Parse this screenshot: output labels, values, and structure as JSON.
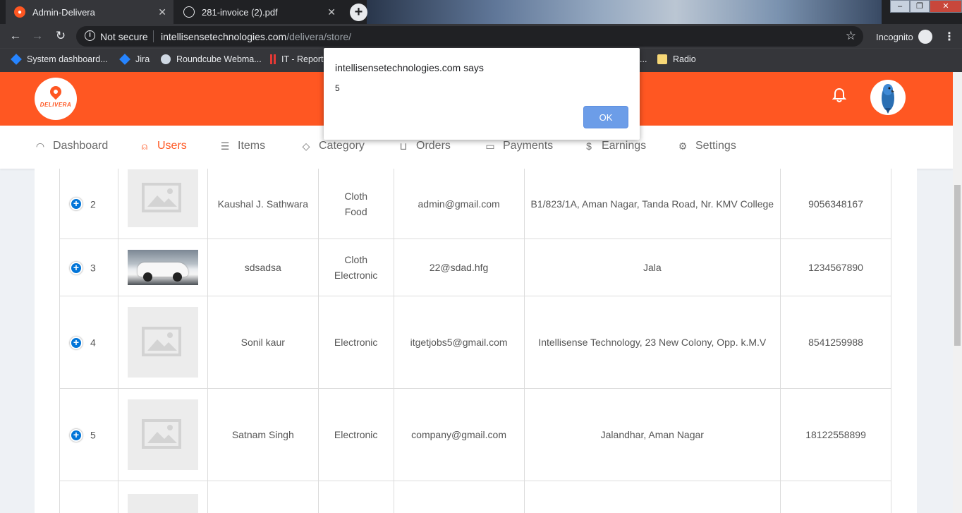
{
  "browser": {
    "tabs": [
      {
        "title": "Admin-Delivera",
        "active": true
      },
      {
        "title": "281-invoice (2).pdf",
        "active": false
      }
    ],
    "new_tab": "+",
    "close_glyph": "✕",
    "security_label": "Not secure",
    "url_host": "intellisensetechnologies.com",
    "url_path": "/delivera/store/",
    "incognito_label": "Incognito",
    "bookmarks": [
      {
        "label": "System dashboard...",
        "icon": "jira-diamond-icon"
      },
      {
        "label": "Jira",
        "icon": "jira-diamond-icon"
      },
      {
        "label": "Roundcube Webma...",
        "icon": "roundcube-icon"
      },
      {
        "label": "IT - Report",
        "icon": "report-icon"
      },
      {
        "label": "...",
        "icon": "none"
      },
      {
        "label": "Radio",
        "icon": "folder-icon"
      }
    ]
  },
  "app": {
    "brand": "DELIVERA",
    "accent_color": "#ff5722",
    "menu": [
      {
        "label": "Dashboard",
        "icon": "speedometer-icon",
        "active": false
      },
      {
        "label": "Users",
        "icon": "user-icon",
        "active": true
      },
      {
        "label": "Items",
        "icon": "list-icon",
        "active": false
      },
      {
        "label": "Category",
        "icon": "tag-icon",
        "active": false
      },
      {
        "label": "Orders",
        "icon": "cart-icon",
        "active": false
      },
      {
        "label": "Payments",
        "icon": "wallet-icon",
        "active": false
      },
      {
        "label": "Earnings",
        "icon": "dollar-icon",
        "active": false
      },
      {
        "label": "Settings",
        "icon": "gear-icon",
        "active": false
      }
    ]
  },
  "users_table": {
    "rows": [
      {
        "index": "2",
        "image": "placeholder",
        "name": "Kaushal J. Sathwara",
        "category_1": "Cloth",
        "category_2": "Food",
        "email": "admin@gmail.com",
        "address": "B1/823/1A, Aman Nagar, Tanda Road, Nr. KMV College",
        "phone": "9056348167"
      },
      {
        "index": "3",
        "image": "car-photo",
        "name": "sdsadsa",
        "category_1": "Cloth",
        "category_2": "Electronic",
        "email": "22@sdad.hfg",
        "address": "Jala",
        "phone": "1234567890"
      },
      {
        "index": "4",
        "image": "placeholder",
        "name": "Sonil kaur",
        "category_1": "Electronic",
        "category_2": "",
        "email": "itgetjobs5@gmail.com",
        "address": "Intellisense Technology, 23 New Colony, Opp. k.M.V",
        "phone": "8541259988"
      },
      {
        "index": "5",
        "image": "placeholder",
        "name": "Satnam Singh",
        "category_1": "Electronic",
        "category_2": "",
        "email": "company@gmail.com",
        "address": "Jalandhar, Aman Nagar",
        "phone": "18122558899"
      }
    ]
  },
  "alert": {
    "title": "intellisensetechnologies.com says",
    "message": "5",
    "ok_label": "OK"
  }
}
